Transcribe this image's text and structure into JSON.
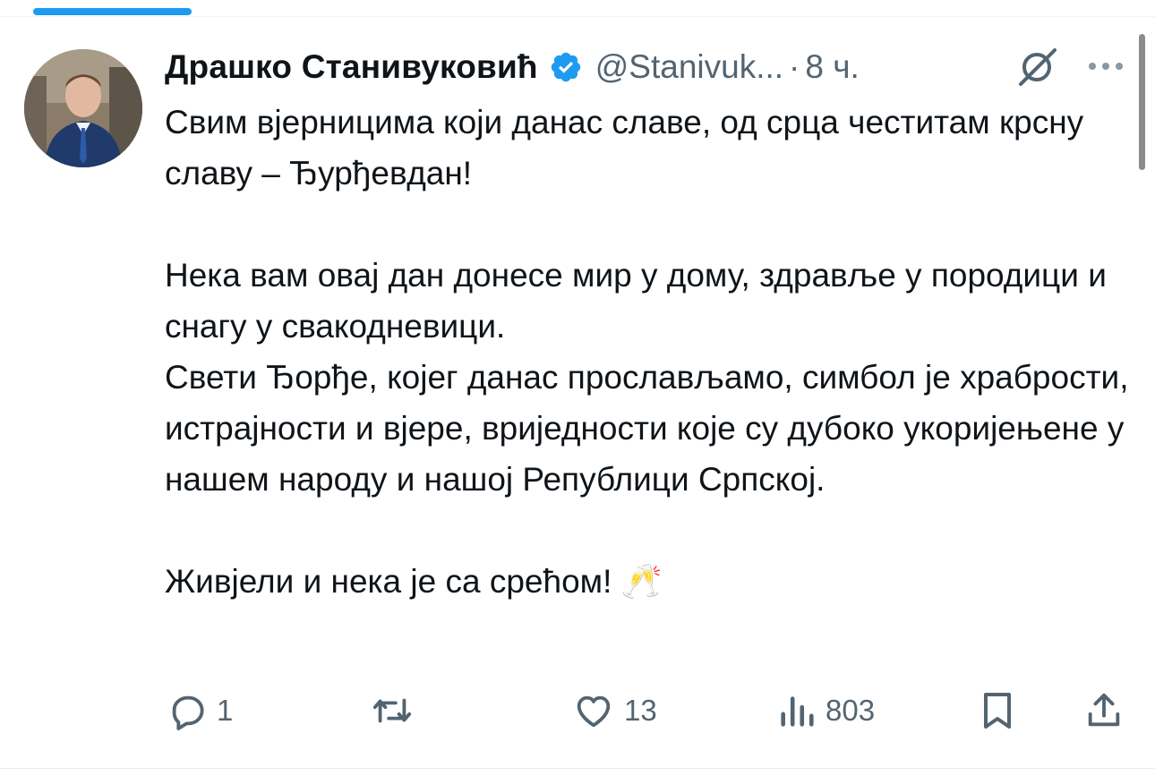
{
  "tweet": {
    "author": {
      "display_name": "Драшко Станивуковић",
      "handle": "@Stanivuk...",
      "verified": true
    },
    "separator": "·",
    "time": "8 ч.",
    "text_paragraphs": [
      "Свим вјерницима који данас славе, од срца честитам крсну славу – Ђурђевдан!",
      "Нека вам овај дан донесе мир у дому, здравље у породици и снагу у свакодневици.\nСвети Ђорђе, којег данас прослављамо, симбол је храбрости, истрајности и вјере, вриједности које су дубоко укоријењене у нашем народу и нашој Републици Српској.",
      "Живјели и нека је са срећом! 🥂"
    ],
    "stats": {
      "replies": "1",
      "retweets": "",
      "likes": "13",
      "views": "803"
    }
  },
  "icons": {
    "verified": "verified-badge-icon",
    "grok": "grok-icon",
    "more": "more-options-icon",
    "reply": "reply-icon",
    "retweet": "retweet-icon",
    "like": "like-icon",
    "views": "views-icon",
    "bookmark": "bookmark-icon",
    "share": "share-icon"
  },
  "colors": {
    "accent": "#1d9bf0",
    "text": "#0f1419",
    "secondary": "#536471"
  }
}
